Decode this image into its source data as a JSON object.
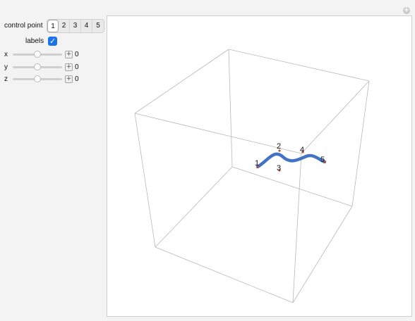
{
  "controls": {
    "control_point_label": "control point",
    "control_point_options": [
      "1",
      "2",
      "3",
      "4",
      "5"
    ],
    "control_point_selected": "1",
    "labels_label": "labels",
    "labels_checked": true,
    "sliders": [
      {
        "axis": "x",
        "value": "0",
        "level": 0.5
      },
      {
        "axis": "y",
        "value": "0",
        "level": 0.5
      },
      {
        "axis": "z",
        "value": "0",
        "level": 0.5
      }
    ]
  },
  "plot": {
    "point_labels": [
      "1",
      "2",
      "3",
      "4",
      "5"
    ],
    "curve_color": "#4472c4",
    "point_marker_color": "#c0502d",
    "box_line_color": "#b8b8b8"
  }
}
